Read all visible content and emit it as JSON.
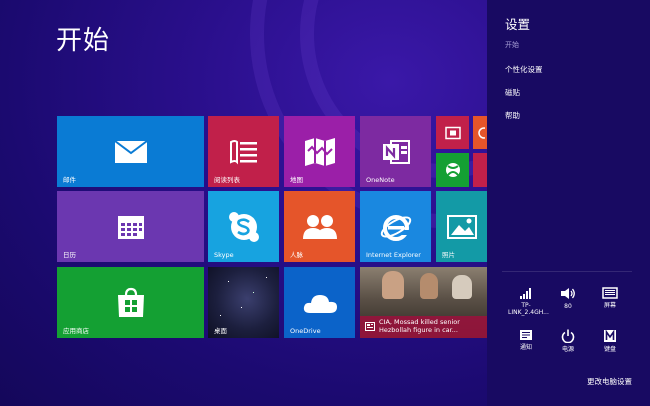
{
  "start": {
    "title": "开始"
  },
  "tiles": {
    "mail": "邮件",
    "reading_list": "阅读列表",
    "maps": "地图",
    "onenote": "OneNote",
    "calendar": "日历",
    "skype": "Skype",
    "people": "人脉",
    "ie": "Internet Explorer",
    "photos": "照片",
    "store": "应用商店",
    "desktop": "桌面",
    "onedrive": "OneDrive",
    "news": "CIA, Mossad killed senior Hezbollah figure in car..."
  },
  "settings": {
    "title": "设置",
    "subtitle": "开始",
    "items": [
      "个性化设置",
      "磁贴",
      "帮助"
    ],
    "quick": {
      "network": "TP-LINK_2.4GH...",
      "volume": "80",
      "screen": "屏幕",
      "notifications": "通知",
      "power": "电源",
      "keyboard": "键盘"
    },
    "change_pc_settings": "更改电脑设置"
  },
  "colors": {
    "mail": "#0a7bd4",
    "reading": "#c1204a",
    "maps": "#9b1fa8",
    "onenote": "#7d2aa1",
    "calendar": "#6b37b0",
    "skype": "#17a3e0",
    "people": "#e5552a",
    "ie": "#1a88e0",
    "photos": "#139aa6",
    "store": "#14a033",
    "onedrive": "#0b63c9",
    "panel": "#180a62"
  }
}
